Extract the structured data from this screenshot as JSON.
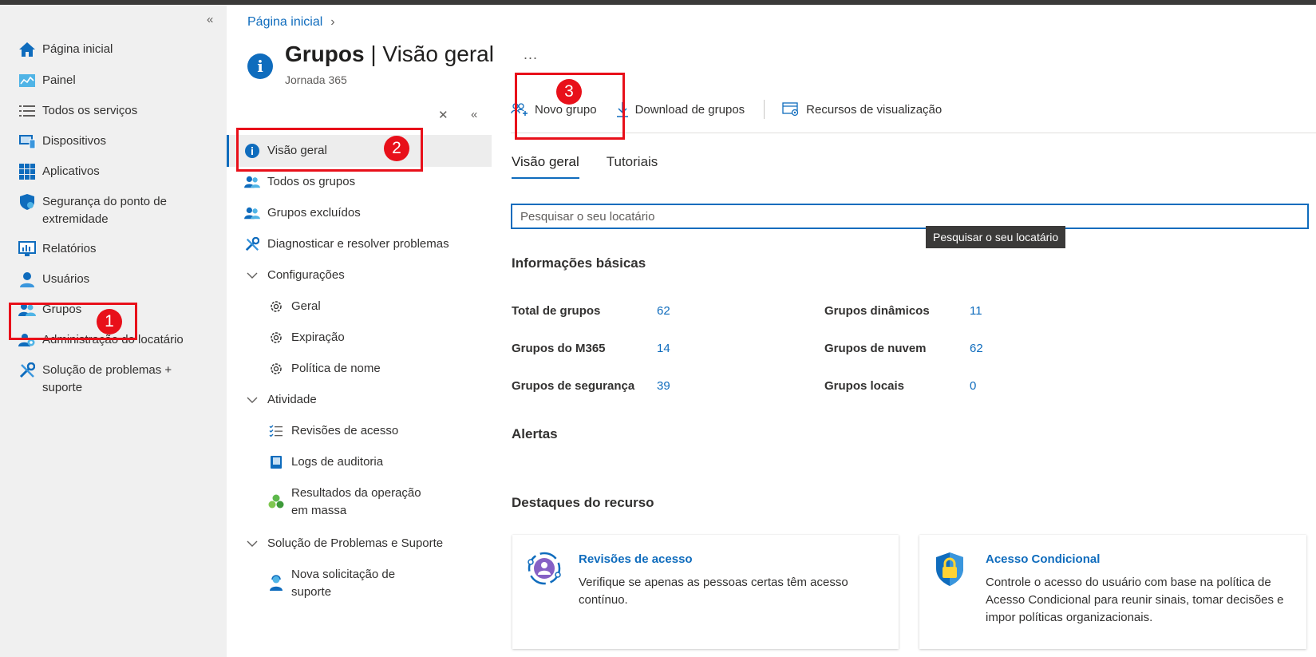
{
  "leftnav": {
    "items": [
      {
        "label": "Página inicial",
        "icon": "home-icon"
      },
      {
        "label": "Painel",
        "icon": "dashboard-icon"
      },
      {
        "label": "Todos os serviços",
        "icon": "list-icon"
      },
      {
        "label": "Dispositivos",
        "icon": "device-icon"
      },
      {
        "label": "Aplicativos",
        "icon": "apps-grid-icon"
      },
      {
        "label": "Segurança do ponto de extremidade",
        "icon": "shield-icon"
      },
      {
        "label": "Relatórios",
        "icon": "reports-icon"
      },
      {
        "label": "Usuários",
        "icon": "user-icon"
      },
      {
        "label": "Grupos",
        "icon": "groups-icon"
      },
      {
        "label": "Administração do locatário",
        "icon": "tenant-admin-icon"
      },
      {
        "label": "Solução de problemas + suporte",
        "icon": "wrench-icon"
      }
    ]
  },
  "breadcrumb": {
    "home": "Página inicial"
  },
  "header": {
    "title_bold": "Grupos",
    "title_rest": " | Visão geral",
    "subtitle": "Jornada 365",
    "more": "..."
  },
  "menu": {
    "items": [
      {
        "label": "Visão geral"
      },
      {
        "label": "Todos os grupos"
      },
      {
        "label": "Grupos excluídos"
      },
      {
        "label": "Diagnosticar e resolver problemas"
      },
      {
        "label": "Configurações"
      },
      {
        "label": "Geral"
      },
      {
        "label": "Expiração"
      },
      {
        "label": "Política de nome"
      },
      {
        "label": "Atividade"
      },
      {
        "label": "Revisões de acesso"
      },
      {
        "label": "Logs de auditoria"
      },
      {
        "label": "Resultados da operação em massa"
      },
      {
        "label": "Solução de Problemas e Suporte"
      },
      {
        "label": "Nova solicitação de suporte"
      }
    ]
  },
  "toolbar": {
    "new_group": "Novo grupo",
    "download": "Download de grupos",
    "preview": "Recursos de visualização"
  },
  "tabs": {
    "overview": "Visão geral",
    "tutorials": "Tutoriais"
  },
  "search": {
    "placeholder": "Pesquisar o seu locatário",
    "tooltip": "Pesquisar o seu locatário"
  },
  "basic_info": {
    "heading": "Informações básicas",
    "stats": [
      {
        "label": "Total de grupos",
        "value": "62"
      },
      {
        "label": "Grupos do M365",
        "value": "14"
      },
      {
        "label": "Grupos de segurança",
        "value": "39"
      },
      {
        "label": "Grupos dinâmicos",
        "value": "11"
      },
      {
        "label": "Grupos de nuvem",
        "value": "62"
      },
      {
        "label": "Grupos locais",
        "value": "0"
      }
    ]
  },
  "alerts": {
    "heading": "Alertas"
  },
  "highlights": {
    "heading": "Destaques do recurso",
    "cards": [
      {
        "title": "Revisões de acesso",
        "desc": "Verifique se apenas as pessoas certas têm acesso contínuo."
      },
      {
        "title": "Acesso Condicional",
        "desc": "Controle o acesso do usuário com base na política de Acesso Condicional para reunir sinais, tomar decisões e impor políticas organizacionais."
      }
    ]
  },
  "annotations": {
    "badges": [
      "1",
      "2",
      "3"
    ],
    "color": "#e8101a"
  },
  "colors": {
    "accent": "#0f6cbd",
    "nav_bg": "#f0f0f0"
  }
}
